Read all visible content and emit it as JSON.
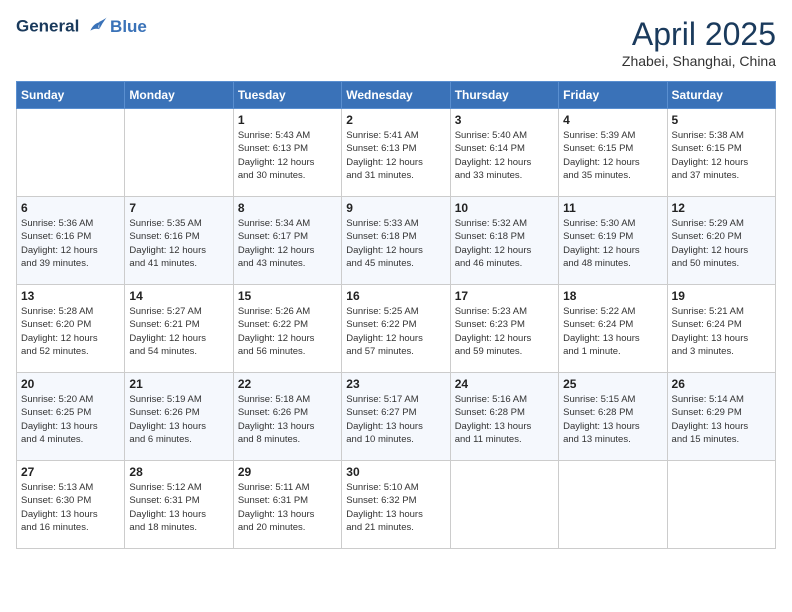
{
  "header": {
    "logo_line1": "General",
    "logo_line2": "Blue",
    "month_title": "April 2025",
    "location": "Zhabei, Shanghai, China"
  },
  "weekdays": [
    "Sunday",
    "Monday",
    "Tuesday",
    "Wednesday",
    "Thursday",
    "Friday",
    "Saturday"
  ],
  "weeks": [
    [
      {
        "day": "",
        "info": ""
      },
      {
        "day": "",
        "info": ""
      },
      {
        "day": "1",
        "info": "Sunrise: 5:43 AM\nSunset: 6:13 PM\nDaylight: 12 hours\nand 30 minutes."
      },
      {
        "day": "2",
        "info": "Sunrise: 5:41 AM\nSunset: 6:13 PM\nDaylight: 12 hours\nand 31 minutes."
      },
      {
        "day": "3",
        "info": "Sunrise: 5:40 AM\nSunset: 6:14 PM\nDaylight: 12 hours\nand 33 minutes."
      },
      {
        "day": "4",
        "info": "Sunrise: 5:39 AM\nSunset: 6:15 PM\nDaylight: 12 hours\nand 35 minutes."
      },
      {
        "day": "5",
        "info": "Sunrise: 5:38 AM\nSunset: 6:15 PM\nDaylight: 12 hours\nand 37 minutes."
      }
    ],
    [
      {
        "day": "6",
        "info": "Sunrise: 5:36 AM\nSunset: 6:16 PM\nDaylight: 12 hours\nand 39 minutes."
      },
      {
        "day": "7",
        "info": "Sunrise: 5:35 AM\nSunset: 6:16 PM\nDaylight: 12 hours\nand 41 minutes."
      },
      {
        "day": "8",
        "info": "Sunrise: 5:34 AM\nSunset: 6:17 PM\nDaylight: 12 hours\nand 43 minutes."
      },
      {
        "day": "9",
        "info": "Sunrise: 5:33 AM\nSunset: 6:18 PM\nDaylight: 12 hours\nand 45 minutes."
      },
      {
        "day": "10",
        "info": "Sunrise: 5:32 AM\nSunset: 6:18 PM\nDaylight: 12 hours\nand 46 minutes."
      },
      {
        "day": "11",
        "info": "Sunrise: 5:30 AM\nSunset: 6:19 PM\nDaylight: 12 hours\nand 48 minutes."
      },
      {
        "day": "12",
        "info": "Sunrise: 5:29 AM\nSunset: 6:20 PM\nDaylight: 12 hours\nand 50 minutes."
      }
    ],
    [
      {
        "day": "13",
        "info": "Sunrise: 5:28 AM\nSunset: 6:20 PM\nDaylight: 12 hours\nand 52 minutes."
      },
      {
        "day": "14",
        "info": "Sunrise: 5:27 AM\nSunset: 6:21 PM\nDaylight: 12 hours\nand 54 minutes."
      },
      {
        "day": "15",
        "info": "Sunrise: 5:26 AM\nSunset: 6:22 PM\nDaylight: 12 hours\nand 56 minutes."
      },
      {
        "day": "16",
        "info": "Sunrise: 5:25 AM\nSunset: 6:22 PM\nDaylight: 12 hours\nand 57 minutes."
      },
      {
        "day": "17",
        "info": "Sunrise: 5:23 AM\nSunset: 6:23 PM\nDaylight: 12 hours\nand 59 minutes."
      },
      {
        "day": "18",
        "info": "Sunrise: 5:22 AM\nSunset: 6:24 PM\nDaylight: 13 hours\nand 1 minute."
      },
      {
        "day": "19",
        "info": "Sunrise: 5:21 AM\nSunset: 6:24 PM\nDaylight: 13 hours\nand 3 minutes."
      }
    ],
    [
      {
        "day": "20",
        "info": "Sunrise: 5:20 AM\nSunset: 6:25 PM\nDaylight: 13 hours\nand 4 minutes."
      },
      {
        "day": "21",
        "info": "Sunrise: 5:19 AM\nSunset: 6:26 PM\nDaylight: 13 hours\nand 6 minutes."
      },
      {
        "day": "22",
        "info": "Sunrise: 5:18 AM\nSunset: 6:26 PM\nDaylight: 13 hours\nand 8 minutes."
      },
      {
        "day": "23",
        "info": "Sunrise: 5:17 AM\nSunset: 6:27 PM\nDaylight: 13 hours\nand 10 minutes."
      },
      {
        "day": "24",
        "info": "Sunrise: 5:16 AM\nSunset: 6:28 PM\nDaylight: 13 hours\nand 11 minutes."
      },
      {
        "day": "25",
        "info": "Sunrise: 5:15 AM\nSunset: 6:28 PM\nDaylight: 13 hours\nand 13 minutes."
      },
      {
        "day": "26",
        "info": "Sunrise: 5:14 AM\nSunset: 6:29 PM\nDaylight: 13 hours\nand 15 minutes."
      }
    ],
    [
      {
        "day": "27",
        "info": "Sunrise: 5:13 AM\nSunset: 6:30 PM\nDaylight: 13 hours\nand 16 minutes."
      },
      {
        "day": "28",
        "info": "Sunrise: 5:12 AM\nSunset: 6:31 PM\nDaylight: 13 hours\nand 18 minutes."
      },
      {
        "day": "29",
        "info": "Sunrise: 5:11 AM\nSunset: 6:31 PM\nDaylight: 13 hours\nand 20 minutes."
      },
      {
        "day": "30",
        "info": "Sunrise: 5:10 AM\nSunset: 6:32 PM\nDaylight: 13 hours\nand 21 minutes."
      },
      {
        "day": "",
        "info": ""
      },
      {
        "day": "",
        "info": ""
      },
      {
        "day": "",
        "info": ""
      }
    ]
  ]
}
